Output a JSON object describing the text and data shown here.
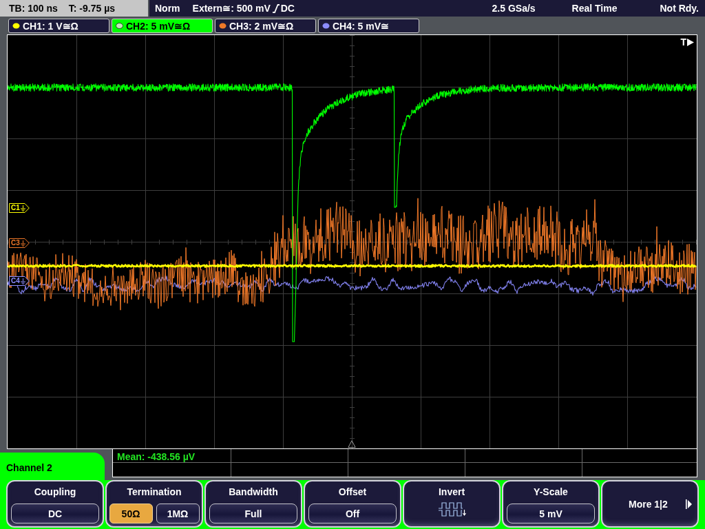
{
  "status_bar": {
    "timebase": "TB: 100 ns",
    "trigger_time": "T: -9.75 µs",
    "mode": "Norm",
    "trigger_source": "Extern≅: 500 mV",
    "trigger_coupling": "DC",
    "sample_rate": "2.5 GSa/s",
    "acquisition": "Real Time",
    "state": "Not Rdy."
  },
  "channel_tabs": [
    {
      "label": "CH1: 1 V≅Ω",
      "color": "#ffff00",
      "selected": false
    },
    {
      "label": "CH2: 5 mV≅Ω",
      "color": "#c0e8b8",
      "selected": true
    },
    {
      "label": "CH3: 2 mV≅Ω",
      "color": "#f07828",
      "selected": false
    },
    {
      "label": "CH4: 5 mV≅",
      "color": "#8c8cff",
      "selected": false
    }
  ],
  "waveform_display": {
    "trigger_label": "T",
    "channel_markers": [
      {
        "label": "C1",
        "color": "#ffff00"
      },
      {
        "label": "C3",
        "color": "#f07828"
      },
      {
        "label": "C4",
        "color": "#8c8cff"
      }
    ]
  },
  "measurement": {
    "reading": "Mean: -438.56 µV"
  },
  "menu": {
    "title": "Channel 2",
    "softkeys": [
      {
        "kind": "value",
        "title": "Coupling",
        "value": "DC"
      },
      {
        "kind": "choice",
        "title": "Termination",
        "options": [
          {
            "label": "50Ω",
            "selected": true
          },
          {
            "label": "1MΩ",
            "selected": false
          }
        ]
      },
      {
        "kind": "value",
        "title": "Bandwidth",
        "value": "Full"
      },
      {
        "kind": "value",
        "title": "Offset",
        "value": "Off"
      },
      {
        "kind": "icon",
        "title": "Invert"
      },
      {
        "kind": "value",
        "title": "Y-Scale",
        "value": "5 mV"
      },
      {
        "kind": "more",
        "title": "More 1|2"
      }
    ]
  }
}
